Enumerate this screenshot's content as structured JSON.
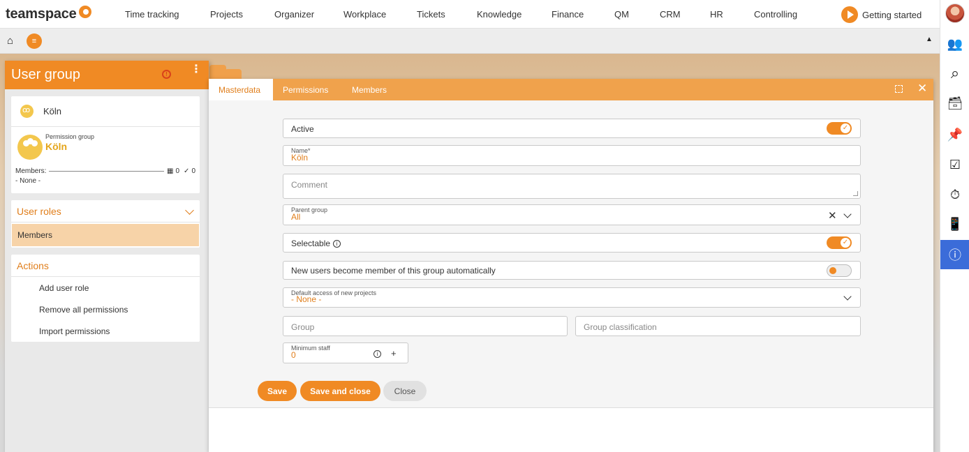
{
  "topnav": {
    "logo": "teamspace",
    "items": [
      "Time tracking",
      "Projects",
      "Organizer",
      "Workplace",
      "Tickets",
      "Knowledge",
      "Finance",
      "QM",
      "CRM",
      "HR",
      "Controlling"
    ],
    "getting_started": "Getting started"
  },
  "rightrail": {
    "icons": [
      "users-icon",
      "search-icon",
      "inbox-icon",
      "pin-icon",
      "checklist-icon",
      "stopwatch-icon",
      "mobile-icon",
      "info-icon"
    ],
    "glyphs": [
      "👥",
      "⌕",
      "🗃",
      "📌",
      "☑",
      "⏱",
      "📱",
      "ⓘ"
    ],
    "active": "info-icon"
  },
  "subbar": {
    "home_glyph": "⌂",
    "menu_glyph": "≡",
    "collapse_glyph": "▲"
  },
  "left_panel": {
    "title": "User group",
    "alert_glyph": "!",
    "more_glyph": "⋮",
    "group_name": "Köln",
    "permission_label": "Permission group",
    "permission_name": "Köln",
    "members_label": "Members:",
    "members_count_icon": "▦",
    "members_count": "0",
    "members_check": "✓",
    "members_checked": "0",
    "members_none": "- None -",
    "user_roles_heading": "User roles",
    "members_item": "Members",
    "actions_heading": "Actions",
    "actions": [
      "Add user role",
      "Remove all permissions",
      "Import permissions"
    ]
  },
  "dialog": {
    "tabs": [
      "Masterdata",
      "Permissions",
      "Members"
    ],
    "active_tab": "Masterdata",
    "close_glyph": "✕",
    "active_label": "Active",
    "active_on": true,
    "name_label": "Name*",
    "name_value": "Köln",
    "comment_placeholder": "Comment",
    "parent_group_label": "Parent group",
    "parent_group_value": "All",
    "clear_glyph": "✕",
    "selectable_label": "Selectable",
    "selectable_on": true,
    "auto_member_label": "New users become member of this group automatically",
    "auto_member_on": false,
    "default_access_label": "Default access of new projects",
    "default_access_value": "- None -",
    "group_placeholder": "Group",
    "group_classification_placeholder": "Group classification",
    "minimum_staff_label": "Minimum staff",
    "minimum_staff_value": "0",
    "info_glyph": "i",
    "plus_glyph": "+",
    "buttons": {
      "save": "Save",
      "save_close": "Save and close",
      "close": "Close"
    }
  }
}
